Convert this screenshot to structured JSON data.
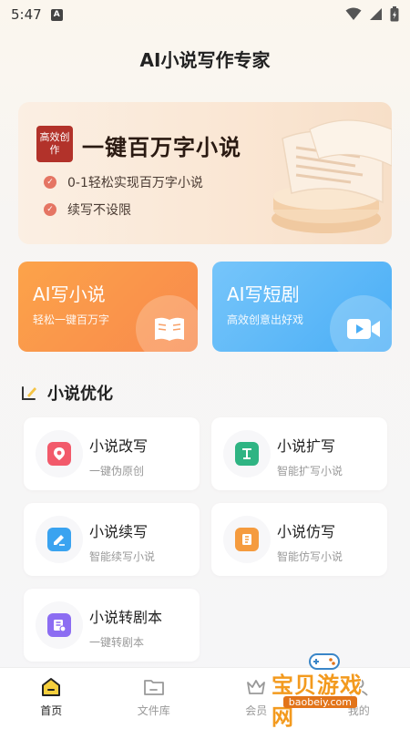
{
  "status_bar": {
    "time": "5:47",
    "notif_letter": "A"
  },
  "header": {
    "title": "AI小说写作专家"
  },
  "banner": {
    "badge": "高效创作",
    "title": "一键百万字小说",
    "points": [
      "0-1轻松实现百万字小说",
      "续写不设限"
    ]
  },
  "features": [
    {
      "title": "AI写小说",
      "subtitle": "轻松一键百万字",
      "icon": "book-icon"
    },
    {
      "title": "AI写短剧",
      "subtitle": "高效创意出好戏",
      "icon": "video-icon"
    }
  ],
  "section": {
    "title": "小说优化"
  },
  "tools": [
    {
      "title": "小说改写",
      "subtitle": "一键伪原创",
      "icon": "rewrite-icon",
      "color": "#f25a6b"
    },
    {
      "title": "小说扩写",
      "subtitle": "智能扩写小说",
      "icon": "text-expand-icon",
      "color": "#2fb483"
    },
    {
      "title": "小说续写",
      "subtitle": "智能续写小说",
      "icon": "continue-icon",
      "color": "#3aa3f0"
    },
    {
      "title": "小说仿写",
      "subtitle": "智能仿写小说",
      "icon": "imitate-icon",
      "color": "#f59b3e"
    },
    {
      "title": "小说转剧本",
      "subtitle": "一键转剧本",
      "icon": "script-icon",
      "color": "#8c6df2"
    }
  ],
  "nav": [
    {
      "label": "首页",
      "icon": "home-icon",
      "active": true
    },
    {
      "label": "文件库",
      "icon": "folder-icon",
      "active": false
    },
    {
      "label": "会员",
      "icon": "vip-icon",
      "active": false
    },
    {
      "label": "我的",
      "icon": "profile-icon",
      "active": false
    }
  ],
  "watermark": {
    "text": "宝贝游戏网",
    "url": "baobeiy.com"
  }
}
